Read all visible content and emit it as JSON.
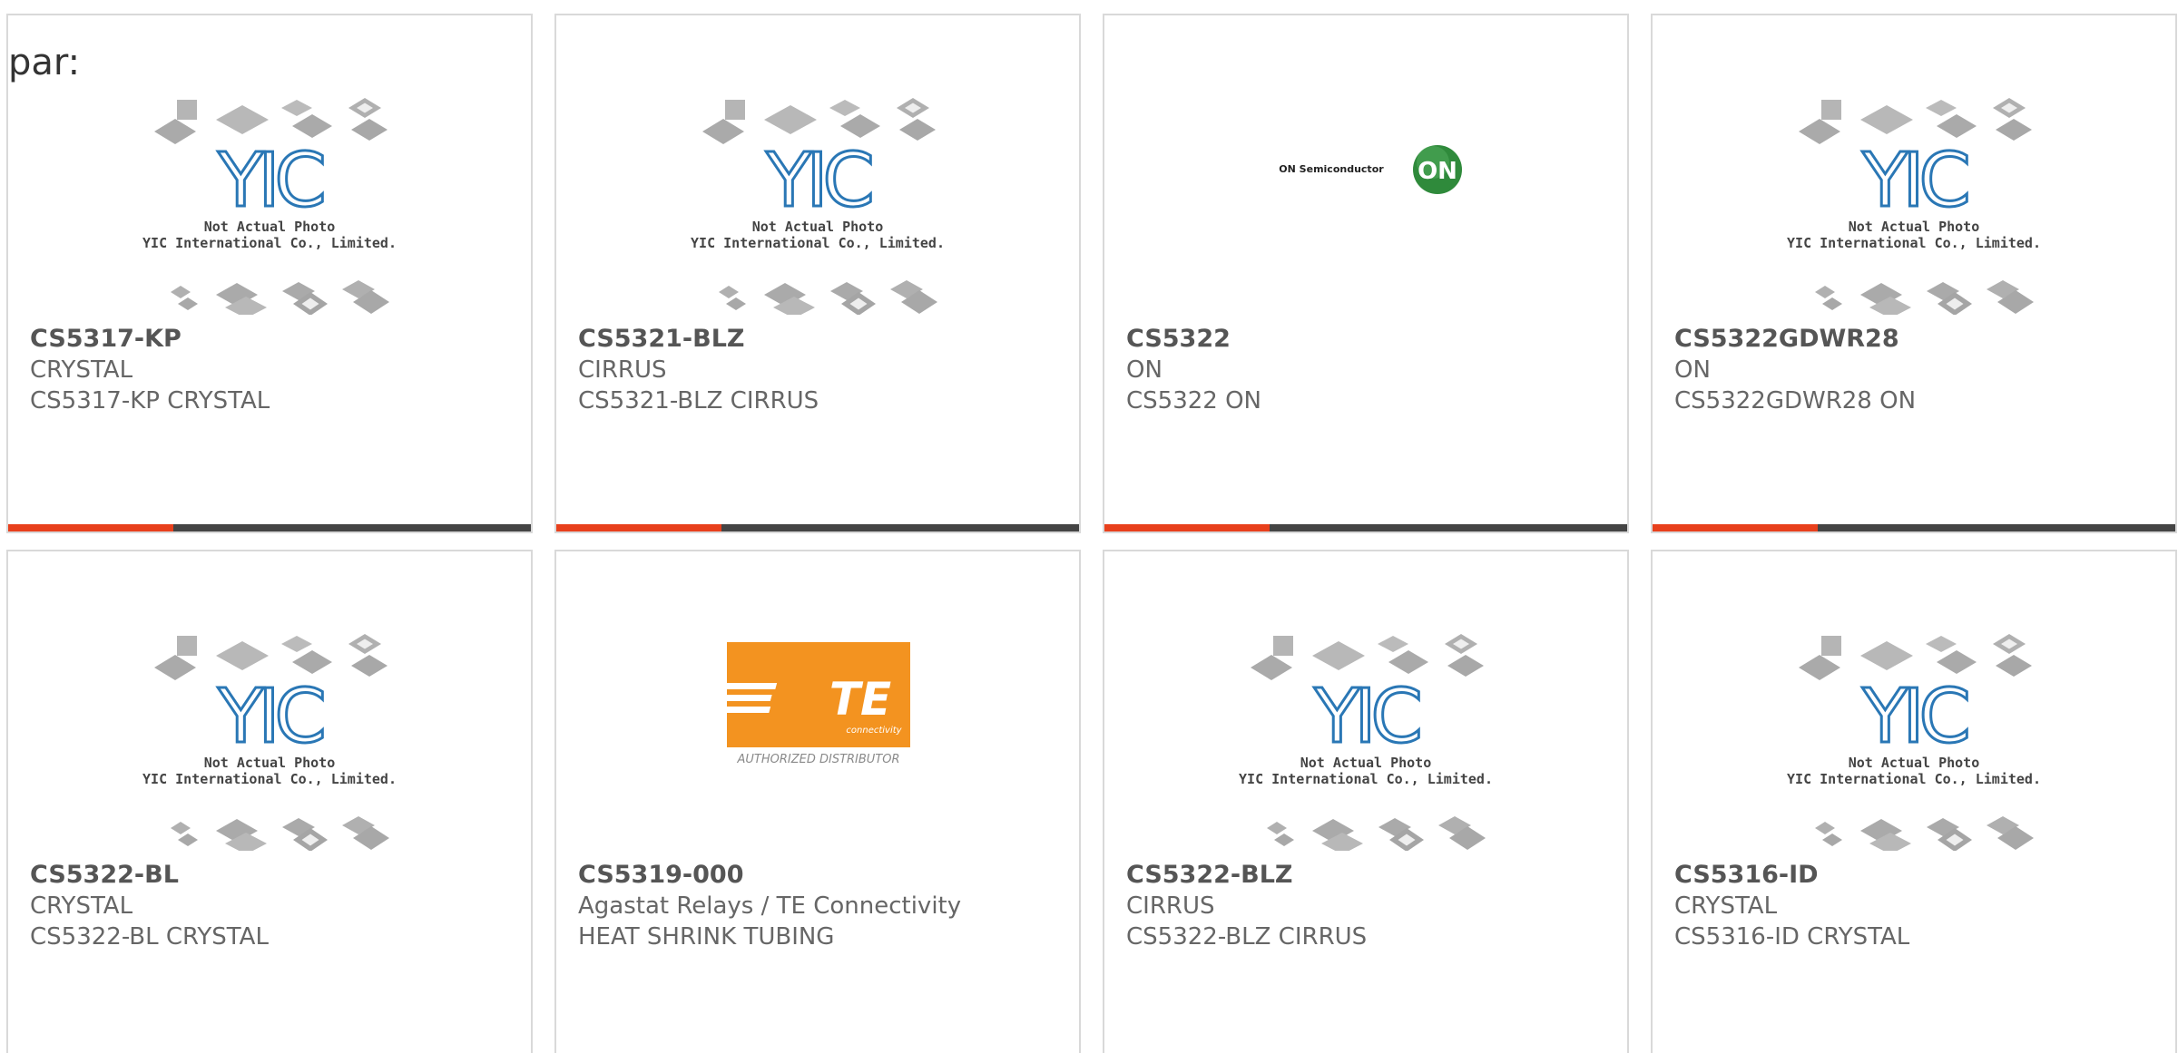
{
  "label": "par:",
  "accent_color": "#e8401c",
  "bar_color": "#444444",
  "yic_placeholder": {
    "brand": "YIC",
    "line1": "Not Actual Photo",
    "line2": "YIC International Co., Limited."
  },
  "on_logo": {
    "wordmark": "ON Semiconductor",
    "badge": "ON"
  },
  "te_logo": {
    "mark": "TE",
    "sub": "connectivity",
    "caption": "AUTHORIZED DISTRIBUTOR"
  },
  "products": [
    {
      "part": "CS5317-KP",
      "manufacturer": "CRYSTAL",
      "description": "CS5317-KP CRYSTAL",
      "image": "yic-placeholder"
    },
    {
      "part": "CS5321-BLZ",
      "manufacturer": "CIRRUS",
      "description": "CS5321-BLZ CIRRUS",
      "image": "yic-placeholder"
    },
    {
      "part": "CS5322",
      "manufacturer": "ON",
      "description": "CS5322 ON",
      "image": "on-semiconductor-logo"
    },
    {
      "part": "CS5322GDWR28",
      "manufacturer": "ON",
      "description": "CS5322GDWR28 ON",
      "image": "yic-placeholder"
    },
    {
      "part": "CS5322-BL",
      "manufacturer": "CRYSTAL",
      "description": "CS5322-BL CRYSTAL",
      "image": "yic-placeholder"
    },
    {
      "part": "CS5319-000",
      "manufacturer": "Agastat Relays / TE Connectivity",
      "description": "HEAT SHRINK TUBING",
      "image": "te-connectivity-logo"
    },
    {
      "part": "CS5322-BLZ",
      "manufacturer": "CIRRUS",
      "description": "CS5322-BLZ CIRRUS",
      "image": "yic-placeholder"
    },
    {
      "part": "CS5316-ID",
      "manufacturer": "CRYSTAL",
      "description": "CS5316-ID CRYSTAL",
      "image": "yic-placeholder"
    }
  ]
}
